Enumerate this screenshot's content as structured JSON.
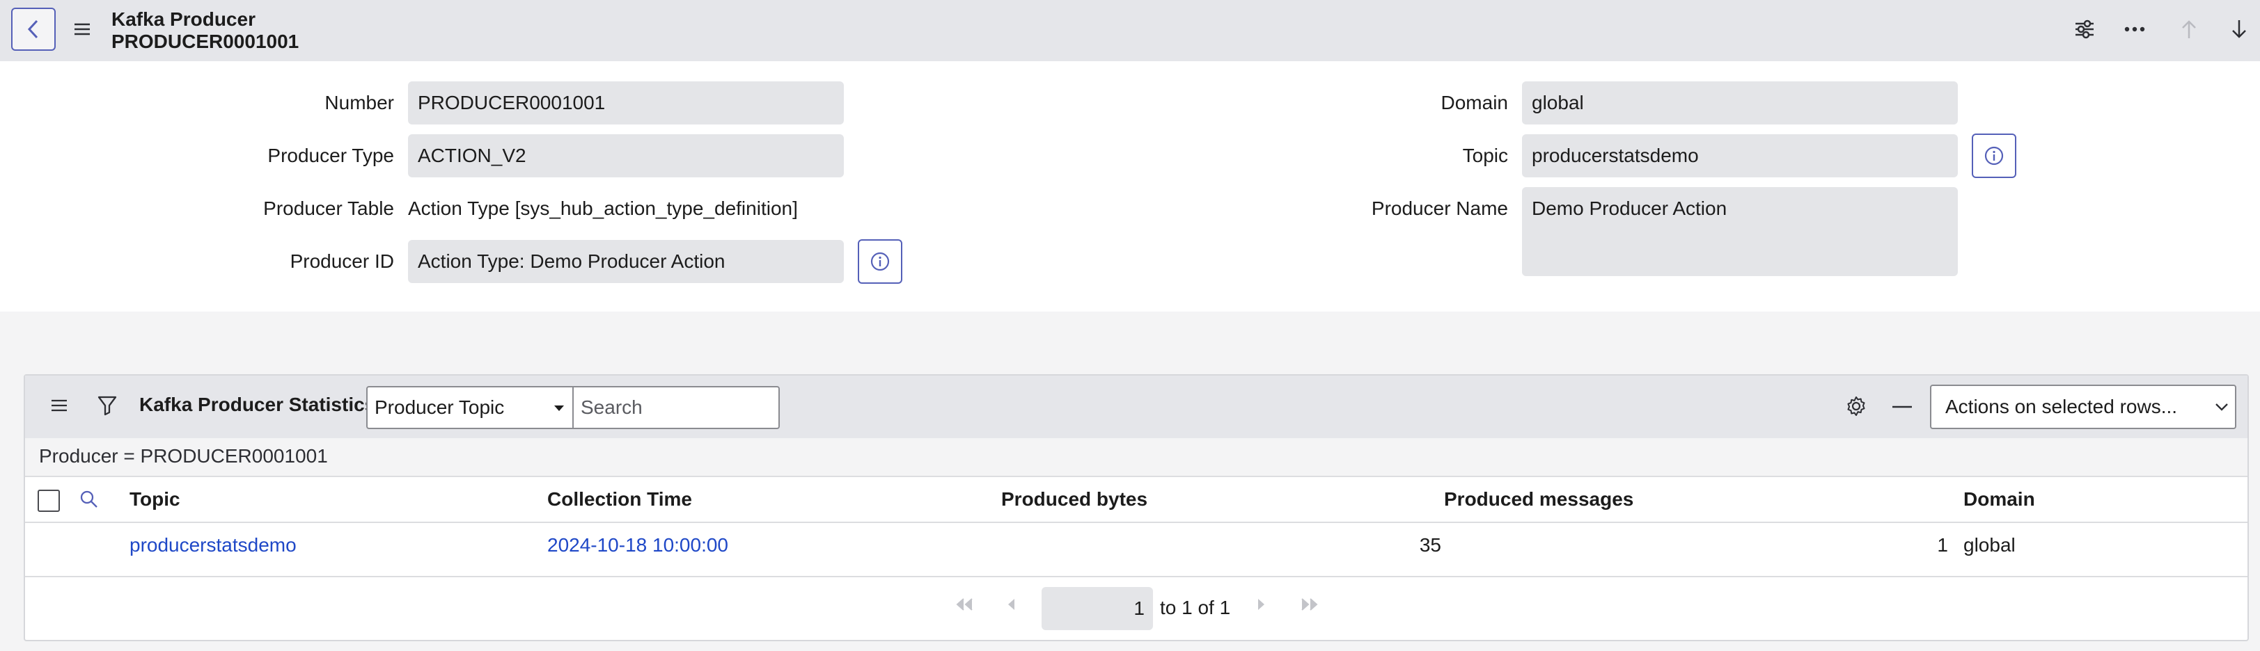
{
  "header": {
    "title": "Kafka Producer",
    "subtitle": "PRODUCER0001001",
    "icons": [
      "back-icon",
      "menu-icon",
      "settings-sliders-icon",
      "more-icon",
      "arrow-up-icon",
      "arrow-down-icon"
    ]
  },
  "form": {
    "number": {
      "label": "Number",
      "value": "PRODUCER0001001"
    },
    "producer_type": {
      "label": "Producer Type",
      "value": "ACTION_V2"
    },
    "producer_table": {
      "label": "Producer Table",
      "value": "Action Type [sys_hub_action_type_definition]"
    },
    "producer_id": {
      "label": "Producer ID",
      "value": "Action Type: Demo Producer Action"
    },
    "domain": {
      "label": "Domain",
      "value": "global"
    },
    "topic": {
      "label": "Topic",
      "value": "producerstatsdemo"
    },
    "producer_name": {
      "label": "Producer Name",
      "value": "Demo Producer Action"
    }
  },
  "related_list": {
    "title": "Kafka Producer Statistics",
    "search_field_select": "Producer Topic",
    "search_placeholder": "Search",
    "actions_select": "Actions on selected rows...",
    "filter": "Producer = PRODUCER0001001",
    "columns": [
      "Topic",
      "Collection Time",
      "Produced bytes",
      "Produced messages",
      "Domain"
    ],
    "rows": [
      {
        "topic": "producerstatsdemo",
        "collection_time": "2024-10-18 10:00:00",
        "produced_bytes": "35",
        "produced_messages": "1",
        "domain": "global"
      }
    ],
    "pagination": {
      "page": "1",
      "range_text": "to 1 of 1"
    }
  },
  "colors": {
    "accent": "#5560b8",
    "link": "#1f48c7",
    "header_bg": "#e5e6ea",
    "field_bg": "#e4e5e8"
  }
}
